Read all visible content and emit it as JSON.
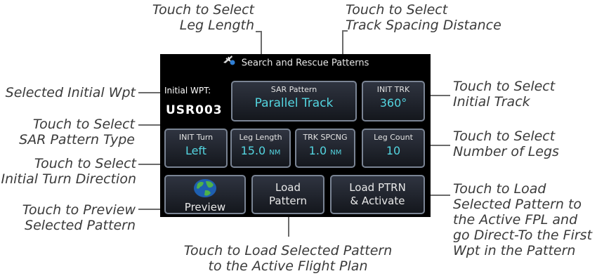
{
  "callouts": {
    "leg_length": [
      "Touch to Select",
      "Leg Length"
    ],
    "track_spacing": [
      "Touch to Select",
      "Track Spacing Distance"
    ],
    "initial_wpt": [
      "Selected Initial Wpt"
    ],
    "pattern_type": [
      "Touch to Select",
      "SAR Pattern Type"
    ],
    "turn_direction": [
      "Touch to Select",
      "Initial Turn Direction"
    ],
    "preview": [
      "Touch to Preview",
      "Selected Pattern"
    ],
    "initial_track": [
      "Touch to Select",
      "Initial Track"
    ],
    "num_legs": [
      "Touch to Select",
      "Number of Legs"
    ],
    "load_activate": [
      "Touch to Load",
      "Selected Pattern to",
      "the Active FPL and",
      "go Direct-To the First",
      "Wpt in the Pattern"
    ],
    "load_pattern": [
      "Touch to Load Selected Pattern",
      "to the Active Flight Plan"
    ]
  },
  "screen": {
    "title": "Search and Rescue Patterns",
    "initial_wpt_label": "Initial WPT:",
    "initial_wpt_value": "USR003",
    "sar_pattern": {
      "label": "SAR Pattern",
      "value": "Parallel Track"
    },
    "init_trk": {
      "label": "INIT TRK",
      "value": "360°"
    },
    "init_turn": {
      "label": "INIT Turn",
      "value": "Left"
    },
    "leg_length": {
      "label": "Leg Length",
      "value": "15.0",
      "unit": "NM"
    },
    "trk_spcng": {
      "label": "TRK SPCNG",
      "value": "1.0",
      "unit": "NM"
    },
    "leg_count": {
      "label": "Leg Count",
      "value": "10"
    },
    "preview_label": "Preview",
    "load_pattern": [
      "Load",
      "Pattern"
    ],
    "load_activate": [
      "Load PTRN",
      "& Activate"
    ]
  },
  "colors": {
    "accent": "#54d5e0",
    "button_border": "#7a8494",
    "callout_text": "#3a3a3a"
  }
}
